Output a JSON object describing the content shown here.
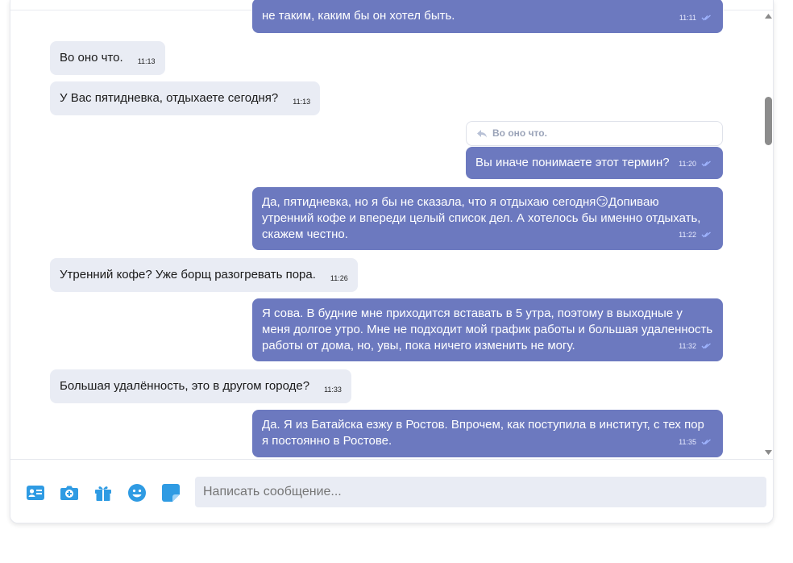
{
  "messages": [
    {
      "dir": "out",
      "text": "не таким, каким бы он хотел быть.",
      "time": "11:11"
    },
    {
      "dir": "in",
      "text": "Во оно что.",
      "time": "11:13"
    },
    {
      "dir": "in",
      "text": "У Вас пятидневка, отдыхаете сегодня?",
      "time": "11:13"
    },
    {
      "dir": "out",
      "reply_to": "Во оно что.",
      "text": "Вы иначе понимаете этот термин?",
      "time": "11:20"
    },
    {
      "dir": "out",
      "text_line1": "Да, пятидневка, но я бы не сказала, что я отдыхаю сегодня",
      "emoji": "😏",
      "text_line1_end": "Допиваю",
      "text_line2": "утренний кофе и впереди целый список дел. А хотелось бы именно отдыхать,",
      "text_line3": "скажем честно.",
      "time": "11:22"
    },
    {
      "dir": "in",
      "text": "Утренний кофе? Уже борщ разогревать пора.",
      "time": "11:26"
    },
    {
      "dir": "out",
      "text_line1": "Я сова. В будние мне приходится вставать в 5 утра, поэтому в выходные у",
      "text_line2": "меня долгое утро. Мне не подходит мой график работы и большая удаленность",
      "text_line3": "работы от дома, но, увы, пока ничего изменить не могу.",
      "time": "11:32"
    },
    {
      "dir": "in",
      "text": "Большая удалённость, это в другом городе?",
      "time": "11:33"
    },
    {
      "dir": "out",
      "text_line1": "Да. Я из Батайска езжу в Ростов. Впрочем, как поступила в институт, с тех пор",
      "text_line2": "я постоянно в Ростове.",
      "time": "11:35"
    }
  ],
  "composer": {
    "placeholder": "Написать сообщение...",
    "icons": [
      "contact-card-icon",
      "camera-icon",
      "gift-icon",
      "emoji-icon",
      "sticker-icon"
    ]
  },
  "colors": {
    "outgoing": "#6c79bf",
    "incoming": "#e9ecf4",
    "accent": "#2f9be3"
  }
}
